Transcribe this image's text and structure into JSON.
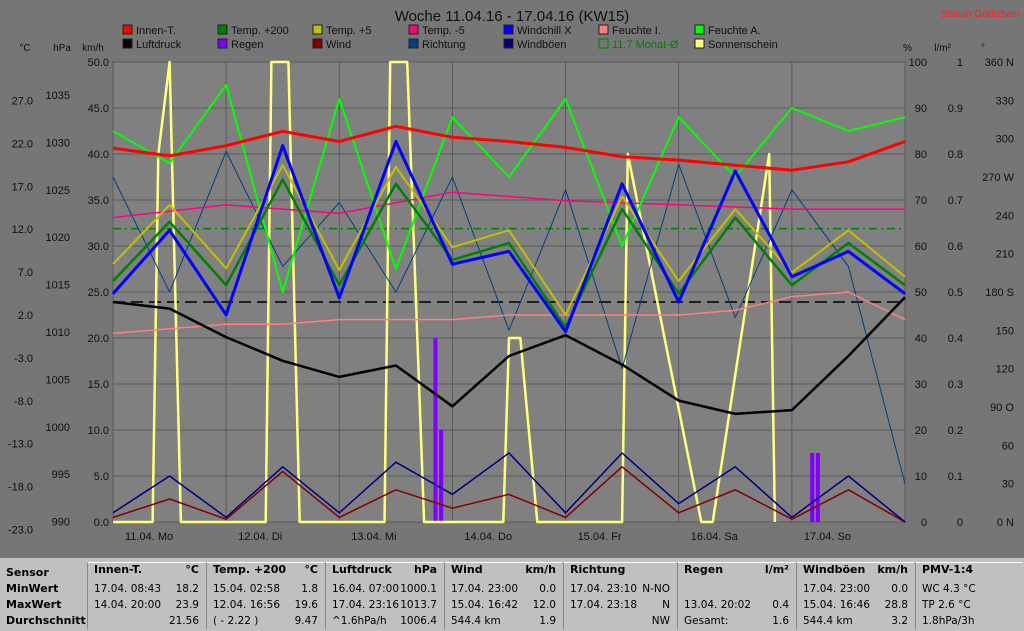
{
  "chart_data": {
    "type": "line",
    "title": "Woche 11.04.16 - 17.04.16 (KW15)",
    "station": "Station Göritzhain",
    "legend": [
      {
        "name": "Innen-T.",
        "color": "#ff0000"
      },
      {
        "name": "Luftdruck",
        "color": "#000000"
      },
      {
        "name": "Temp. +200",
        "color": "#008000"
      },
      {
        "name": "Regen",
        "color": "#8000ff"
      },
      {
        "name": "Temp. +5",
        "color": "#c0c000"
      },
      {
        "name": "Wind",
        "color": "#800000"
      },
      {
        "name": "Temp. -5",
        "color": "#ff0080"
      },
      {
        "name": "Richtung",
        "color": "#004080"
      },
      {
        "name": "Windchill X",
        "color": "#0000ff"
      },
      {
        "name": "Windböen",
        "color": "#000080"
      },
      {
        "name": "Feuchte I.",
        "color": "#ff8080"
      },
      {
        "name": "11.7 Monat-Ø",
        "color": "#008000"
      },
      {
        "name": "Feuchte A.",
        "color": "#00ff00"
      },
      {
        "name": "Sonnenschein",
        "color": "#ffff80"
      }
    ],
    "axis_units": [
      "°C",
      "hPa",
      "km/h",
      "%",
      "l/m²",
      "°"
    ],
    "axes": {
      "temp": {
        "ticks": [
          "27.0",
          "22.0",
          "17.0",
          "12.0",
          "7.0",
          "2.0",
          "-3.0",
          "-8.0",
          "-13.0",
          "-18.0",
          "-23.0"
        ],
        "range": [
          -23,
          31.4
        ]
      },
      "pressure": {
        "ticks": [
          "1035",
          "1030",
          "1025",
          "1020",
          "1015",
          "1010",
          "1005",
          "1000",
          "995",
          "990"
        ],
        "range": [
          990,
          1038.5
        ]
      },
      "wind": {
        "ticks": [
          "50.0",
          "45.0",
          "40.0",
          "35.0",
          "30.0",
          "25.0",
          "20.0",
          "15.0",
          "10.0",
          "5.0",
          "0.0"
        ],
        "range": [
          0,
          50
        ]
      },
      "humidity": {
        "ticks": [
          "100",
          "90",
          "80",
          "70",
          "60",
          "50",
          "40",
          "30",
          "20",
          "10",
          "0"
        ],
        "range": [
          0,
          100
        ]
      },
      "rain": {
        "ticks": [
          "1",
          "0.9",
          "0.8",
          "0.7",
          "0.6",
          "0.5",
          "0.4",
          "0.3",
          "0.2",
          "0.1",
          "0"
        ],
        "range": [
          0,
          1
        ]
      },
      "direction": {
        "ticks": [
          "360 N",
          "330",
          "300",
          "270 W",
          "240",
          "210",
          "180 S",
          "150",
          "120",
          "90 O",
          "60",
          "30",
          "0 N"
        ],
        "range": [
          0,
          360
        ]
      }
    },
    "x_labels": [
      "11.04. Mo",
      "12.04. Di",
      "13.04. Mi",
      "14.04. Do",
      "15.04. Fr",
      "16.04. Sa",
      "17.04. So"
    ],
    "x_range_days": [
      0,
      7
    ],
    "series": [
      {
        "name": "Innen-T.",
        "axis": "temp",
        "x": [
          0,
          0.5,
          1,
          1.5,
          2,
          2.5,
          3,
          3.5,
          4,
          4.5,
          5,
          5.5,
          6,
          6.5,
          7
        ],
        "y": [
          21.2,
          20.3,
          21.5,
          23.2,
          22.0,
          23.8,
          22.5,
          22.0,
          21.3,
          20.2,
          19.8,
          19.2,
          18.6,
          19.6,
          22.0
        ]
      },
      {
        "name": "Luftdruck",
        "axis": "pressure",
        "x": [
          0,
          0.5,
          1,
          1.5,
          2,
          2.5,
          3,
          3.5,
          4,
          4.5,
          5,
          5.5,
          6,
          6.5,
          7
        ],
        "y": [
          1013.2,
          1012.5,
          1009.5,
          1007.0,
          1005.3,
          1006.5,
          1002.2,
          1007.5,
          1009.7,
          1006.6,
          1002.8,
          1001.4,
          1001.8,
          1007.5,
          1013.7
        ]
      },
      {
        "name": "Temp. +200",
        "axis": "temp",
        "x": [
          0,
          0.5,
          1,
          1.5,
          2,
          2.5,
          3,
          3.5,
          4,
          4.5,
          5,
          5.5,
          6,
          6.5,
          7
        ],
        "y": [
          5.5,
          12.5,
          5.0,
          17.5,
          5.0,
          17.0,
          8.0,
          10.0,
          0.0,
          14.0,
          4.0,
          13.0,
          5.0,
          10.0,
          5.0
        ]
      },
      {
        "name": "Temp. +5",
        "axis": "temp",
        "x": [
          0,
          0.5,
          1,
          1.5,
          2,
          2.5,
          3,
          3.5,
          4,
          4.5,
          5,
          5.5,
          6,
          6.5,
          7
        ],
        "y": [
          7.5,
          14.5,
          7.0,
          19.2,
          6.8,
          19.0,
          9.5,
          11.5,
          1.5,
          15.5,
          5.5,
          14.0,
          6.5,
          11.5,
          6.0
        ]
      },
      {
        "name": "Windchill X",
        "axis": "temp",
        "x": [
          0,
          0.5,
          1,
          1.5,
          2,
          2.5,
          3,
          3.5,
          4,
          4.5,
          5,
          5.5,
          6,
          6.5,
          7
        ],
        "y": [
          4.0,
          11.5,
          1.5,
          21.5,
          3.5,
          22.0,
          7.5,
          9.0,
          -0.5,
          17.0,
          3.0,
          18.5,
          6.0,
          9.0,
          4.0
        ]
      },
      {
        "name": "Temp. -5",
        "axis": "temp",
        "x": [
          0,
          1,
          2,
          3,
          4,
          5,
          6,
          7
        ],
        "y": [
          13.0,
          14.5,
          13.5,
          16.0,
          15.0,
          14.5,
          14.0,
          14.0
        ]
      },
      {
        "name": "Feuchte A.",
        "axis": "humidity",
        "x": [
          0,
          0.5,
          1,
          1.5,
          2,
          2.5,
          3,
          3.5,
          4,
          4.5,
          5,
          5.5,
          6,
          6.5,
          7
        ],
        "y": [
          85,
          78,
          95,
          50,
          92,
          55,
          88,
          75,
          92,
          60,
          88,
          75,
          90,
          85,
          88
        ]
      },
      {
        "name": "Feuchte I.",
        "axis": "humidity",
        "x": [
          0,
          0.5,
          1,
          1.5,
          2,
          2.5,
          3,
          3.5,
          4,
          4.5,
          5,
          5.5,
          6,
          6.5,
          7
        ],
        "y": [
          41,
          42,
          43,
          43,
          44,
          44,
          44,
          45,
          45,
          45,
          45,
          46,
          49,
          50,
          44
        ]
      },
      {
        "name": "Wind",
        "axis": "wind",
        "x": [
          0,
          0.5,
          1,
          1.5,
          2,
          2.5,
          3,
          3.5,
          4,
          4.5,
          5,
          5.5,
          6,
          6.5,
          7
        ],
        "y": [
          0.5,
          2.5,
          0.3,
          5.5,
          0.5,
          3.5,
          1.5,
          3.0,
          0.5,
          6.0,
          1.0,
          3.5,
          0.3,
          3.5,
          0.0
        ]
      },
      {
        "name": "Windböen",
        "axis": "wind",
        "x": [
          0,
          0.5,
          1,
          1.5,
          2,
          2.5,
          3,
          3.5,
          4,
          4.5,
          5,
          5.5,
          6,
          6.5,
          7
        ],
        "y": [
          1.0,
          5.0,
          0.5,
          6.0,
          1.0,
          6.5,
          3.0,
          7.5,
          1.0,
          7.5,
          2.0,
          6.0,
          0.5,
          5.0,
          0.0
        ]
      },
      {
        "name": "Richtung",
        "axis": "direction",
        "x": [
          0,
          0.5,
          1,
          1.5,
          2,
          2.5,
          3,
          3.5,
          4,
          4.5,
          5,
          5.5,
          6,
          6.5,
          7
        ],
        "y": [
          270,
          180,
          290,
          200,
          250,
          180,
          270,
          150,
          260,
          120,
          280,
          160,
          260,
          200,
          30
        ]
      },
      {
        "name": "Sonnenschein",
        "axis": "humidity",
        "x": [
          0,
          0.35,
          0.4,
          0.5,
          0.6,
          1.0,
          1.35,
          1.4,
          1.55,
          1.65,
          2.05,
          2.4,
          2.45,
          2.6,
          2.75,
          3.45,
          3.5,
          3.6,
          3.75,
          4.5,
          4.55,
          5.2,
          5.3,
          5.8,
          5.85
        ],
        "y": [
          0,
          0,
          80,
          100,
          0,
          0,
          0,
          100,
          100,
          0,
          0,
          0,
          100,
          100,
          0,
          0,
          40,
          40,
          0,
          0,
          80,
          0,
          0,
          80,
          0
        ]
      }
    ],
    "rain_bars": [
      {
        "x": 2.85,
        "value": 0.4
      },
      {
        "x": 2.9,
        "value": 0.2
      },
      {
        "x": 6.18,
        "value": 0.15
      },
      {
        "x": 6.23,
        "value": 0.15
      }
    ],
    "reference_lines": [
      {
        "name": "11.7 Monat-Ø",
        "axis": "temp",
        "value": 11.7,
        "color": "#008000",
        "style": "dashdot"
      },
      {
        "name": "Luftdruck Referenz",
        "axis": "pressure",
        "value": 1013.2,
        "color": "#000000",
        "style": "dashed"
      }
    ],
    "grid": true
  },
  "stats": {
    "row_labels": [
      "Sensor",
      "MinWert",
      "MaxWert",
      "Durchschnitt"
    ],
    "panels": [
      {
        "title": "Innen-T.",
        "unit": "°C",
        "rows": [
          [
            "17.04. 08:43",
            "18.2"
          ],
          [
            "14.04. 20:00",
            "23.9"
          ],
          [
            "",
            "21.56"
          ]
        ]
      },
      {
        "title": "Temp. +200",
        "unit": "°C",
        "rows": [
          [
            "15.04. 02:58",
            "1.8"
          ],
          [
            "12.04. 16:56",
            "19.6"
          ],
          [
            "( - 2.22 )",
            "9.47"
          ]
        ]
      },
      {
        "title": "Luftdruck",
        "unit": "hPa",
        "rows": [
          [
            "16.04. 07:00",
            "1000.1"
          ],
          [
            "17.04. 23:16",
            "1013.7"
          ],
          [
            "^1.6hPa/h",
            "1006.4"
          ]
        ]
      },
      {
        "title": "Wind",
        "unit": "km/h",
        "rows": [
          [
            "17.04. 23:00",
            "0.0"
          ],
          [
            "15.04. 16:42",
            "12.0"
          ],
          [
            "544.4 km",
            "1.9"
          ]
        ]
      },
      {
        "title": "Richtung",
        "unit": "",
        "rows": [
          [
            "17.04. 23:10",
            "N-NO"
          ],
          [
            "17.04. 23:18",
            "N"
          ],
          [
            "",
            "NW"
          ]
        ]
      },
      {
        "title": "Regen",
        "unit": "l/m²",
        "rows": [
          [
            "",
            ""
          ],
          [
            "13.04. 20:02",
            "0.4"
          ],
          [
            "Gesamt:",
            "1.6"
          ]
        ]
      },
      {
        "title": "Windböen",
        "unit": "km/h",
        "rows": [
          [
            "17.04. 23:00",
            "0.0"
          ],
          [
            "15.04. 16:46",
            "28.8"
          ],
          [
            "544.4 km",
            "3.2"
          ]
        ]
      },
      {
        "title": "PMV-1:4",
        "unit": "",
        "rows": [
          [
            "WC 4.3 °C",
            ""
          ],
          [
            "TP 2.6 °C",
            ""
          ],
          [
            "1.8hPa/3h",
            ""
          ]
        ]
      }
    ]
  }
}
